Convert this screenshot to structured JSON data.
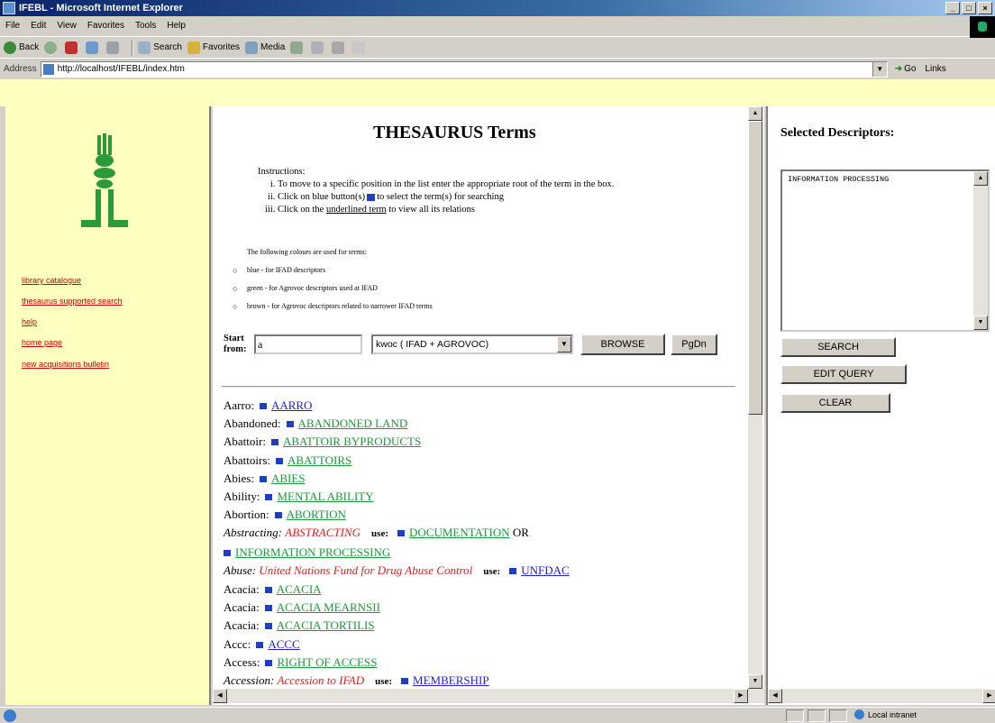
{
  "window": {
    "title": "IFEBL - Microsoft Internet Explorer",
    "min": "_",
    "max": "□",
    "close": "×"
  },
  "menu": [
    "File",
    "Edit",
    "View",
    "Favorites",
    "Tools",
    "Help"
  ],
  "toolbar": {
    "back": "Back",
    "search": "Search",
    "favorites": "Favorites",
    "media": "Media"
  },
  "address": {
    "label": "Address",
    "url": "http://localhost/IFEBL/index.htm",
    "go": "Go",
    "links": "Links"
  },
  "sidebar": {
    "links": [
      "library catalogue",
      "thesaurus supported search",
      "help",
      "home page",
      "new acquisitions bulletin"
    ]
  },
  "main": {
    "title": "THESAURUS Terms",
    "instructions_label": "Instructions:",
    "instructions": [
      "To move to a specific position in the list enter the appropriate root of the term in the box.",
      "Click on blue button(s)",
      "to select the term(s) for searching",
      "Click on the",
      "underlined term",
      "to view all its relations"
    ],
    "legend_intro": "The following colours are used for terms:",
    "legend": [
      "blue - for IFAD descriptors",
      "green - for Agrovoc descriptors used at IFAD",
      "brown - for Agrovoc descriptors related to narrower IFAD terms"
    ],
    "start_label_1": "Start",
    "start_label_2": "from:",
    "start_value": "a",
    "select_value": "kwoc ( IFAD + AGROVOC)",
    "browse": "BROWSE",
    "pgdn": "PgDn",
    "use_label": "use:",
    "or_label": "OR",
    "terms": [
      {
        "kw": "Aarro:",
        "term": "AARRO",
        "color": "blue"
      },
      {
        "kw": "Abandoned:",
        "term": "ABANDONED LAND",
        "color": "green"
      },
      {
        "kw": "Abattoir:",
        "term": "ABATTOIR BYPRODUCTS",
        "color": "green"
      },
      {
        "kw": "Abattoirs:",
        "term": "ABATTOIRS",
        "color": "green"
      },
      {
        "kw": "Abies:",
        "term": "ABIES",
        "color": "green"
      },
      {
        "kw": "Ability:",
        "term": "MENTAL ABILITY",
        "color": "green"
      },
      {
        "kw": "Abortion:",
        "term": "ABORTION",
        "color": "green"
      }
    ],
    "abstracting": {
      "kw": "Abstracting:",
      "nonpref": "ABSTRACTING",
      "use1": "DOCUMENTATION",
      "use2": "INFORMATION PROCESSING"
    },
    "abuse": {
      "kw": "Abuse:",
      "nonpref": "United Nations Fund for Drug Abuse Control",
      "use": "UNFDAC"
    },
    "terms2": [
      {
        "kw": "Acacia:",
        "term": "ACACIA",
        "color": "green"
      },
      {
        "kw": "Acacia:",
        "term": "ACACIA MEARNSII",
        "color": "green"
      },
      {
        "kw": "Acacia:",
        "term": "ACACIA TORTILIS",
        "color": "green"
      },
      {
        "kw": "Accc:",
        "term": "ACCC",
        "color": "blue"
      },
      {
        "kw": "Access:",
        "term": "RIGHT OF ACCESS",
        "color": "green"
      }
    ],
    "accession": {
      "kw": "Accession:",
      "nonpref": "Accession to IFAD",
      "use": "MEMBERSHIP"
    }
  },
  "right": {
    "title": "Selected Descriptors:",
    "selected": "INFORMATION PROCESSING",
    "search": "SEARCH",
    "edit": "EDIT QUERY",
    "clear": "CLEAR"
  },
  "status": {
    "zone": "Local intranet"
  },
  "colors": {
    "blue_term": "#2020d0",
    "green_term": "#1a9a3a",
    "red_term": "#e02020",
    "sidebar_bg": "#ffffc0"
  }
}
